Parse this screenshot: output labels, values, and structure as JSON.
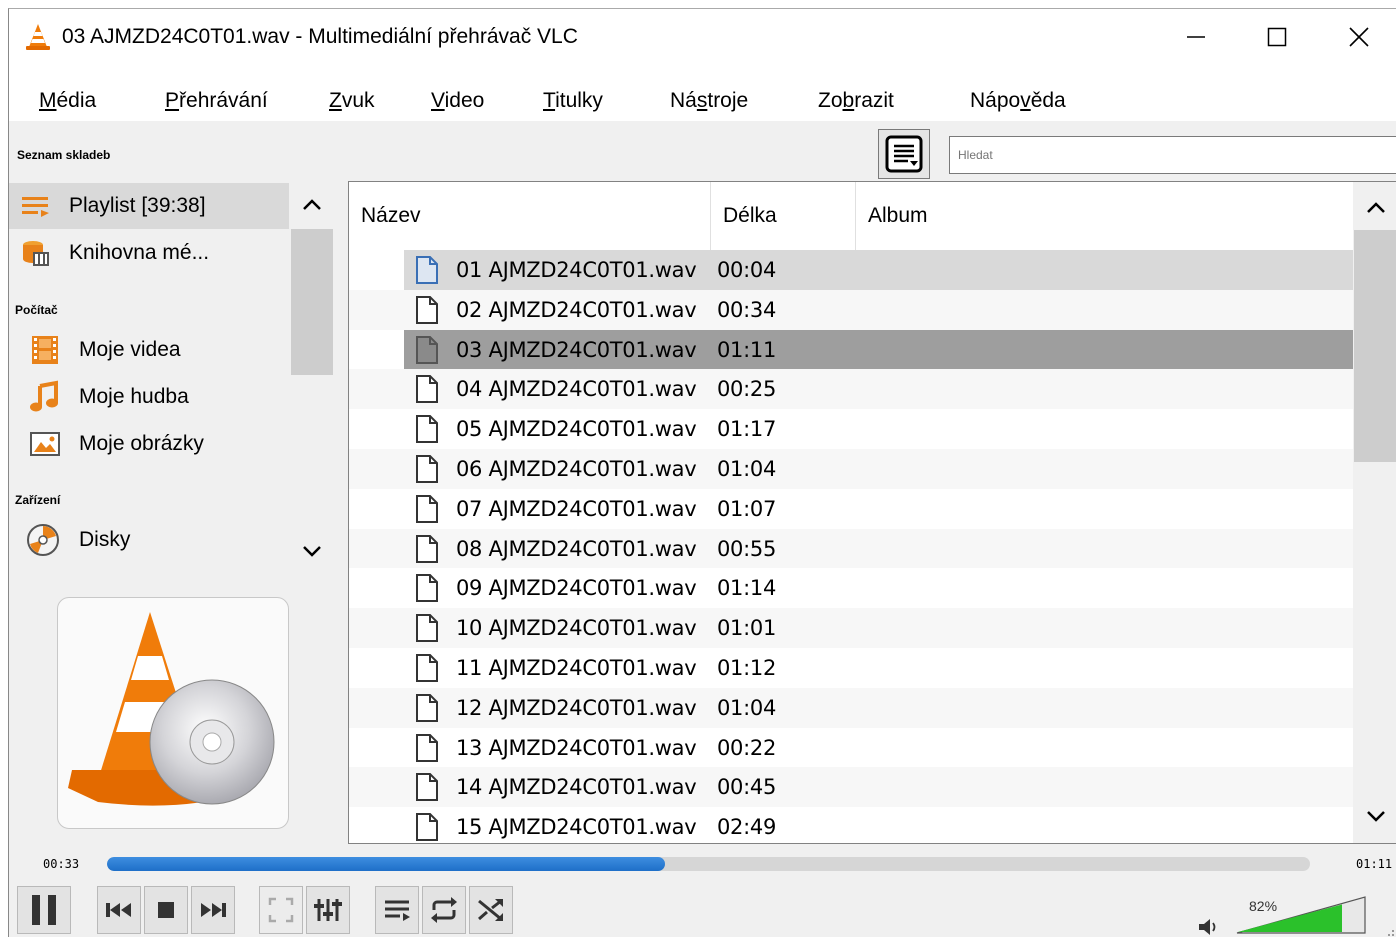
{
  "window": {
    "title": "03 AJMZD24C0T01.wav - Multimediální přehrávač VLC"
  },
  "menu": [
    {
      "pre": "",
      "u": "M",
      "post": "édia"
    },
    {
      "pre": "",
      "u": "P",
      "post": "řehrávání"
    },
    {
      "pre": "",
      "u": "Z",
      "post": "vuk"
    },
    {
      "pre": "",
      "u": "V",
      "post": "ideo"
    },
    {
      "pre": "",
      "u": "T",
      "post": "itulky"
    },
    {
      "pre": "Ná",
      "u": "s",
      "post": "troje"
    },
    {
      "pre": "Zo",
      "u": "b",
      "post": "razit"
    },
    {
      "pre": "Nápo",
      "u": "v",
      "post": "ěda"
    }
  ],
  "toolbar": {
    "playlist_label": "Seznam skladeb",
    "search_placeholder": "Hledat"
  },
  "sidebar": {
    "items": [
      {
        "label": "Playlist [39:38]",
        "icon": "playlist-icon"
      },
      {
        "label": "Knihovna mé...",
        "icon": "library-icon"
      }
    ],
    "section_computer": "Počítač",
    "computer_items": [
      {
        "label": "Moje videa",
        "icon": "film-icon"
      },
      {
        "label": "Moje hudba",
        "icon": "music-note-icon"
      },
      {
        "label": "Moje obrázky",
        "icon": "picture-icon"
      }
    ],
    "section_devices": "Zařízení",
    "device_items": [
      {
        "label": "Disky",
        "icon": "disc-icon"
      }
    ]
  },
  "playlist": {
    "columns": [
      "Název",
      "Délka",
      "Album"
    ],
    "rows": [
      {
        "name": "01 AJMZD24C0T01.wav",
        "length": "00:04"
      },
      {
        "name": "02 AJMZD24C0T01.wav",
        "length": "00:34"
      },
      {
        "name": "03 AJMZD24C0T01.wav",
        "length": "01:11"
      },
      {
        "name": "04 AJMZD24C0T01.wav",
        "length": "00:25"
      },
      {
        "name": "05 AJMZD24C0T01.wav",
        "length": "01:17"
      },
      {
        "name": "06 AJMZD24C0T01.wav",
        "length": "01:04"
      },
      {
        "name": "07 AJMZD24C0T01.wav",
        "length": "01:07"
      },
      {
        "name": "08 AJMZD24C0T01.wav",
        "length": "00:55"
      },
      {
        "name": "09 AJMZD24C0T01.wav",
        "length": "01:14"
      },
      {
        "name": "10 AJMZD24C0T01.wav",
        "length": "01:01"
      },
      {
        "name": "11 AJMZD24C0T01.wav",
        "length": "01:12"
      },
      {
        "name": "12 AJMZD24C0T01.wav",
        "length": "01:04"
      },
      {
        "name": "13 AJMZD24C0T01.wav",
        "length": "00:22"
      },
      {
        "name": "14 AJMZD24C0T01.wav",
        "length": "00:45"
      },
      {
        "name": "15 AJMZD24C0T01.wav",
        "length": "02:49"
      }
    ],
    "selected_row": 1,
    "playing_row": 3
  },
  "player": {
    "elapsed": "00:33",
    "total": "01:11",
    "progress": 0.464,
    "volume_label": "82%",
    "volume": 0.82
  },
  "colors": {
    "seek_fill": "#1e6fc8",
    "volume_fill": "#2bc12b",
    "cone_orange": "#f07c0a"
  }
}
